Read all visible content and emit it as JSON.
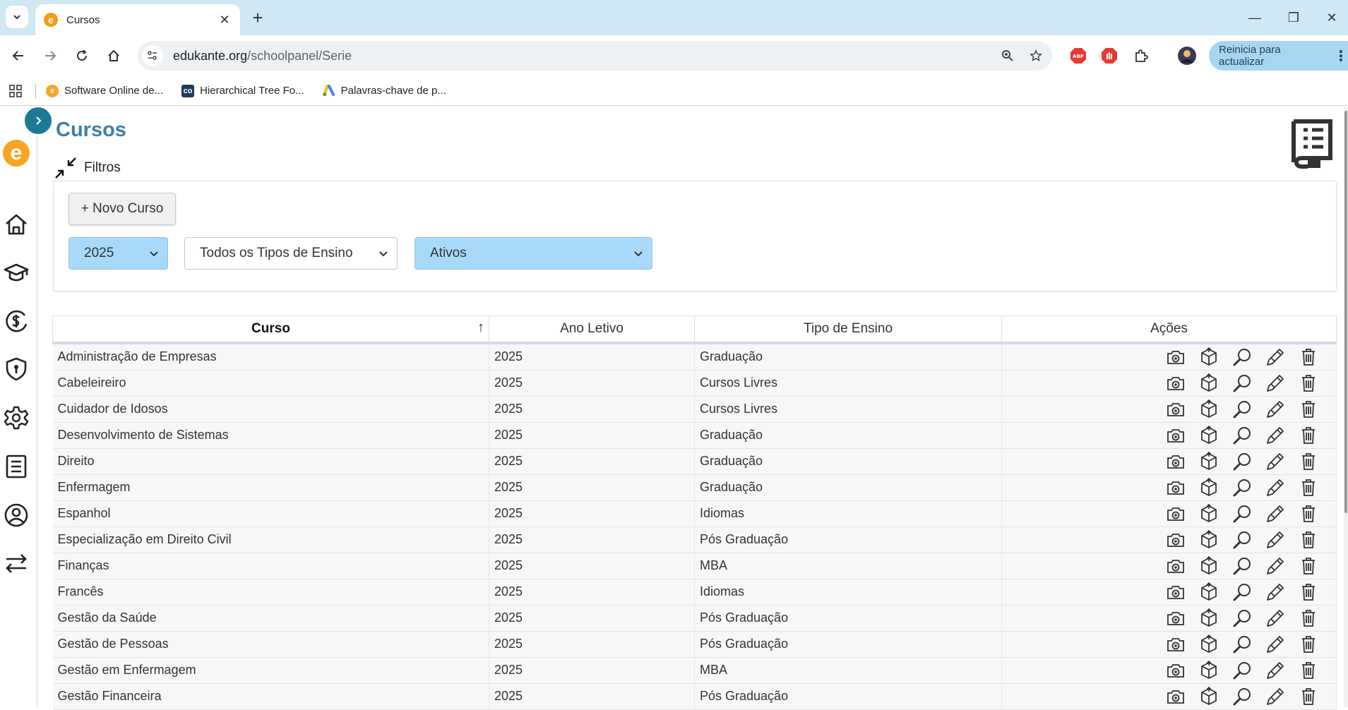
{
  "browser": {
    "tab_title": "Cursos",
    "url_domain": "edukante.org",
    "url_path": "/schoolpanel/Serie",
    "update_button": "Reinicia para actualizar",
    "bookmarks": [
      {
        "label": "Software Online de...",
        "icon": "edukante-favicon"
      },
      {
        "label": "Hierarchical Tree Fo...",
        "icon": "codepen-favicon"
      },
      {
        "label": "Palavras-chave de p...",
        "icon": "google-ads-favicon"
      }
    ]
  },
  "page": {
    "title": "Cursos",
    "filters_label": "Filtros",
    "new_button": "+ Novo Curso",
    "year_select": "2025",
    "type_select": "Todos os Tipos de Ensino",
    "status_select": "Ativos"
  },
  "table": {
    "headers": [
      "Curso",
      "Ano Letivo",
      "Tipo de Ensino",
      "Ações"
    ],
    "rows": [
      [
        "Administração de Empresas",
        "2025",
        "Graduação"
      ],
      [
        "Cabeleireiro",
        "2025",
        "Cursos Livres"
      ],
      [
        "Cuidador de Idosos",
        "2025",
        "Cursos Livres"
      ],
      [
        "Desenvolvimento de Sistemas",
        "2025",
        "Graduação"
      ],
      [
        "Direito",
        "2025",
        "Graduação"
      ],
      [
        "Enfermagem",
        "2025",
        "Graduação"
      ],
      [
        "Espanhol",
        "2025",
        "Idiomas"
      ],
      [
        "Especialização em Direito Civil",
        "2025",
        "Pós Graduação"
      ],
      [
        "Finanças",
        "2025",
        "MBA"
      ],
      [
        "Francês",
        "2025",
        "Idiomas"
      ],
      [
        "Gestão da Saúde",
        "2025",
        "Pós Graduação"
      ],
      [
        "Gestão de Pessoas",
        "2025",
        "Pós Graduação"
      ],
      [
        "Gestão em Enfermagem",
        "2025",
        "MBA"
      ],
      [
        "Gestão Financeira",
        "2025",
        "Pós Graduação"
      ]
    ],
    "row_actions": [
      "camera-icon",
      "box-icon",
      "magnifier-icon",
      "pencil-icon",
      "trash-icon"
    ]
  },
  "sidebar_icons": [
    "home-icon",
    "graduation-cap-icon",
    "money-icon",
    "shield-icon",
    "gear-icon",
    "document-icon",
    "user-icon",
    "transfer-icon"
  ],
  "colors": {
    "title": "#3e7fa6",
    "tabstrip": "#cfe8f3",
    "active_select": "#a8d9f8",
    "sidebar_toggle": "#1b7a94",
    "logo": "#f5a623"
  }
}
